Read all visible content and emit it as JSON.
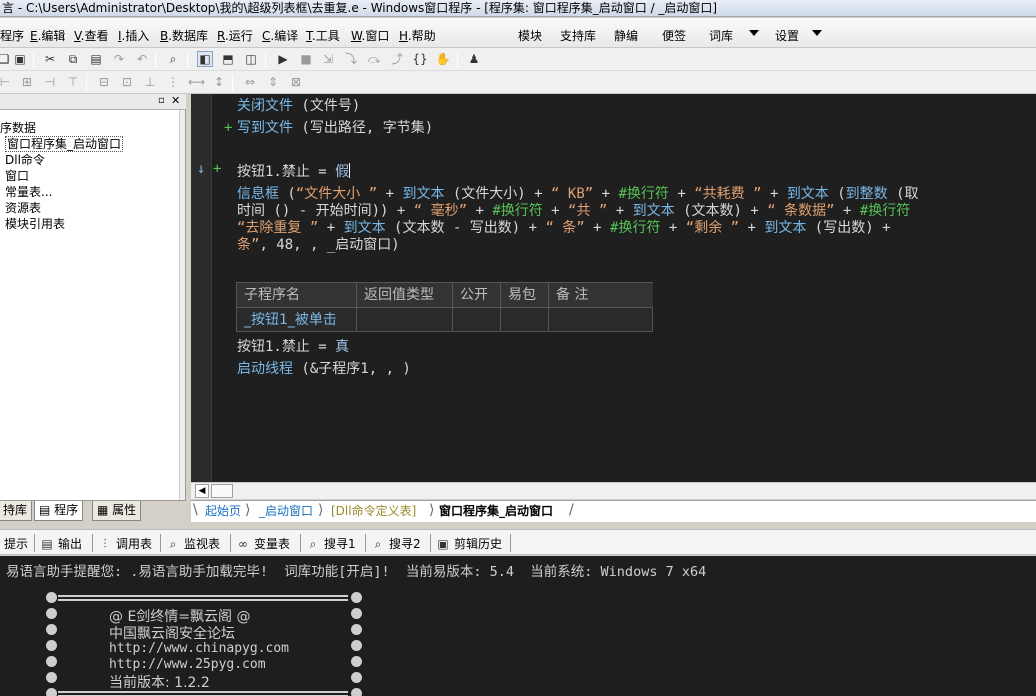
{
  "window": {
    "title": "言 - C:\\Users\\Administrator\\Desktop\\我的\\超级列表框\\去重复.e - Windows窗口程序 - [程序集: 窗口程序集_启动窗口 / _启动窗口]"
  },
  "menu": {
    "items": [
      {
        "label": "程序"
      },
      {
        "key": "E",
        "label": ".编辑"
      },
      {
        "key": "V",
        "label": ".查看"
      },
      {
        "key": "I",
        "label": ".插入"
      },
      {
        "key": "B",
        "label": ".数据库"
      },
      {
        "key": "R",
        "label": ".运行"
      },
      {
        "key": "C",
        "label": ".编译"
      },
      {
        "key": "T",
        "label": ".工具"
      },
      {
        "key": "W",
        "label": ".窗口"
      },
      {
        "key": "H",
        "label": ".帮助"
      }
    ],
    "extras": [
      "模块",
      "支持库",
      "静编",
      "便签",
      "词库",
      "设置"
    ]
  },
  "left_panel": {
    "tree": [
      "序数据",
      "窗口程序集_启动窗口",
      "Dll命令",
      "窗口",
      "常量表...",
      "资源表",
      "模块引用表"
    ],
    "tabs": [
      "持库",
      "程序",
      "属性"
    ]
  },
  "editor": {
    "lines": {
      "l1_a": "关闭文件",
      "l1_b": " (文件号)",
      "l2_a": "写到文件",
      "l2_b": " (写出路径, 字节集)",
      "l3_a": "按钮1.禁止 = ",
      "l3_b": "假",
      "l4": [
        "信息框",
        " (",
        "“文件大小 ”",
        " + ",
        "到文本",
        " (文件大小) + ",
        "“ KB”",
        " + ",
        "#换行符",
        " + ",
        "“共耗费 ”",
        " + ",
        "到文本",
        " (",
        "到整数",
        " (取"
      ],
      "l5": [
        "时间 () - 开始时间)) + ",
        "“ 毫秒”",
        " + ",
        "#换行符",
        " + ",
        "“共 ”",
        " + ",
        "到文本",
        " (文本数) + ",
        "“ 条数据”",
        " + ",
        "#换行符"
      ],
      "l6": [
        "“去除重复 ”",
        " + ",
        "到文本",
        " (文本数 - 写出数) + ",
        "“ 条”",
        " + ",
        "#换行符",
        " + ",
        "“剩余 ”",
        " + ",
        "到文本",
        " (写出数) + "
      ],
      "l7": [
        "条”",
        ", 48, , _启动窗口)"
      ],
      "l8_a": "按钮1.禁止 = ",
      "l8_b": "真",
      "l9_a": "启动线程",
      "l9_b": " (&子程序1, , )"
    },
    "sub_table": {
      "headers": [
        "子程序名",
        "返回值类型",
        "公开",
        "易包",
        "备 注"
      ],
      "row": [
        "_按钮1_被单击",
        "",
        "",
        "",
        ""
      ]
    },
    "gutter_marks": [
      "+",
      "↓",
      "+"
    ],
    "doc_tabs": [
      "起始页",
      "_启动窗口",
      "[Dll命令定义表]",
      "窗口程序集_启动窗口"
    ]
  },
  "output": {
    "tabs": [
      "提示",
      "输出",
      "调用表",
      "监视表",
      "变量表",
      "搜寻1",
      "搜寻2",
      "剪辑历史"
    ],
    "status_line": "易语言助手提醒您: .易语言助手加载完毕!  词库功能[开启]!  当前易版本: 5.4  当前系统: Windows 7 x64",
    "banner": [
      "@ E剑终情=飘云阁 @",
      "中国飘云阁安全论坛",
      "http://www.chinapyg.com",
      "http://www.25pyg.com",
      "当前版本: 1.2.2"
    ]
  },
  "colors": {
    "editor_bg": "#1f1f1f",
    "keyword": "#9fc3e8",
    "string": "#e0a070",
    "constant": "#56c256"
  }
}
